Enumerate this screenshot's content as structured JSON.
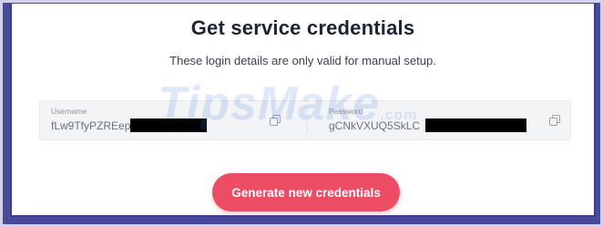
{
  "header": {
    "title": "Get service credentials",
    "subtitle": "These login details are only valid for manual setup."
  },
  "credentials": {
    "username": {
      "label": "Username",
      "value": "fLw9TfyPZREep"
    },
    "password": {
      "label": "Password",
      "value": "gCNkVXUQ5SkLC"
    }
  },
  "actions": {
    "generate_label": "Generate new credentials"
  },
  "watermark": {
    "text": "TipsMake",
    "suffix": ".com"
  },
  "colors": {
    "accent": "#ec4c64",
    "frame": "#4a4a9a",
    "field_bg": "#f3f4f6"
  },
  "icons": {
    "copy": "copy-icon"
  }
}
